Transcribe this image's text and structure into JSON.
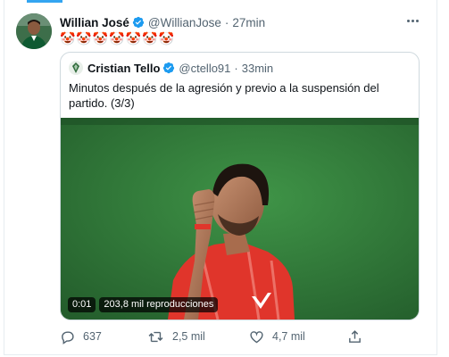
{
  "tweet": {
    "author_name": "Willian José",
    "author_handle": "@WillianJose",
    "separator": "·",
    "time": "27min",
    "text": "🤡🤡🤡🤡🤡🤡🤡",
    "more_icon": "more-horizontal-icon"
  },
  "quoted": {
    "author_name": "Cristian Tello",
    "author_handle": "@ctello91",
    "separator": "·",
    "time": "33min",
    "text": "Minutos después de la agresión y previo a la suspensión del partido. (3/3)",
    "video": {
      "elapsed": "0:01",
      "views": "203,8 mil reproducciones"
    }
  },
  "actions": {
    "replies": "637",
    "retweets": "2,5 mil",
    "likes": "4,7 mil"
  },
  "colors": {
    "verified": "#1d9bf0",
    "secondary_text": "#536471",
    "border": "#cfd9de",
    "pitch_green": "#2f7a38",
    "jersey_red": "#e0352b"
  }
}
